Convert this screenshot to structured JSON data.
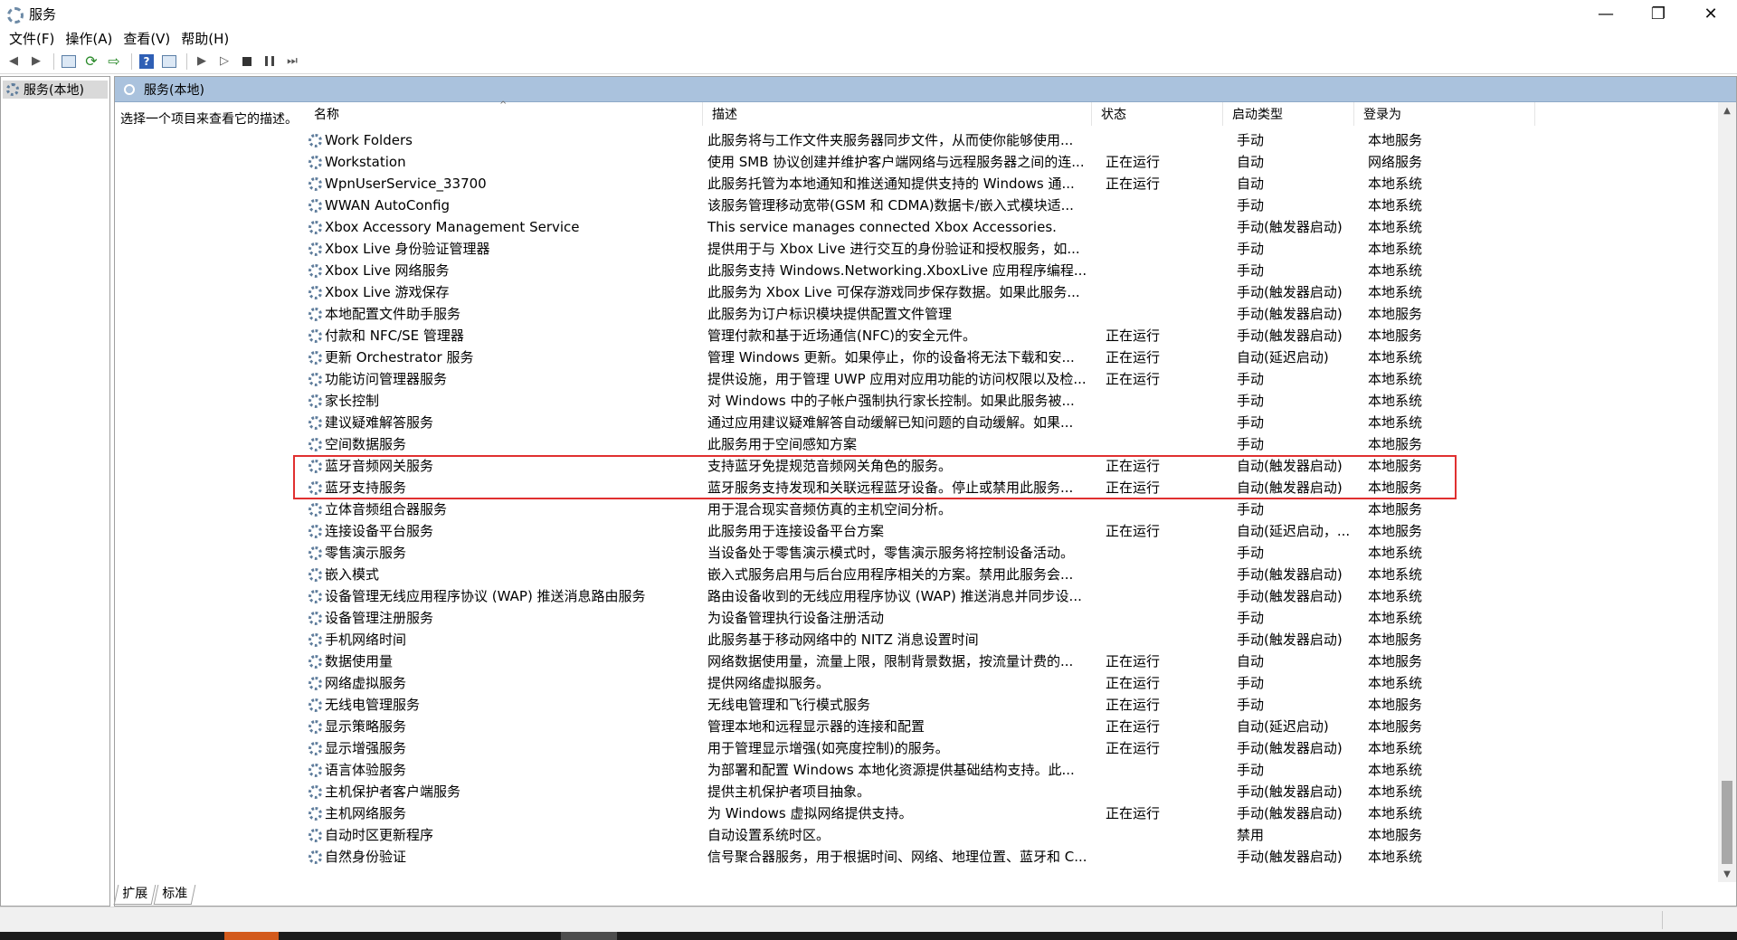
{
  "window": {
    "title": "服务",
    "minimize": "—",
    "maximize": "❐",
    "close": "✕"
  },
  "menu": [
    "文件(F)",
    "操作(A)",
    "查看(V)",
    "帮助(H)"
  ],
  "tree": {
    "root_label": "服务(本地)"
  },
  "header": {
    "title": "服务(本地)"
  },
  "description_panel": "选择一个项目来查看它的描述。",
  "columns": {
    "name": "名称",
    "desc": "描述",
    "status": "状态",
    "start": "启动类型",
    "logon": "登录为"
  },
  "rows": [
    {
      "name": "Work Folders",
      "desc": "此服务将与工作文件夹服务器同步文件，从而使你能够使用...",
      "status": "",
      "start": "手动",
      "logon": "本地服务"
    },
    {
      "name": "Workstation",
      "desc": "使用 SMB 协议创建并维护客户端网络与远程服务器之间的连...",
      "status": "正在运行",
      "start": "自动",
      "logon": "网络服务"
    },
    {
      "name": "WpnUserService_33700",
      "desc": "此服务托管为本地通知和推送通知提供支持的 Windows 通...",
      "status": "正在运行",
      "start": "自动",
      "logon": "本地系统"
    },
    {
      "name": "WWAN AutoConfig",
      "desc": "该服务管理移动宽带(GSM 和 CDMA)数据卡/嵌入式模块适...",
      "status": "",
      "start": "手动",
      "logon": "本地系统"
    },
    {
      "name": "Xbox Accessory Management Service",
      "desc": "This service manages connected Xbox Accessories.",
      "status": "",
      "start": "手动(触发器启动)",
      "logon": "本地系统"
    },
    {
      "name": "Xbox Live 身份验证管理器",
      "desc": "提供用于与 Xbox Live 进行交互的身份验证和授权服务，如...",
      "status": "",
      "start": "手动",
      "logon": "本地系统"
    },
    {
      "name": "Xbox Live 网络服务",
      "desc": "此服务支持 Windows.Networking.XboxLive 应用程序编程...",
      "status": "",
      "start": "手动",
      "logon": "本地系统"
    },
    {
      "name": "Xbox Live 游戏保存",
      "desc": "此服务为 Xbox Live 可保存游戏同步保存数据。如果此服务...",
      "status": "",
      "start": "手动(触发器启动)",
      "logon": "本地系统"
    },
    {
      "name": "本地配置文件助手服务",
      "desc": "此服务为订户标识模块提供配置文件管理",
      "status": "",
      "start": "手动(触发器启动)",
      "logon": "本地服务"
    },
    {
      "name": "付款和 NFC/SE 管理器",
      "desc": "管理付款和基于近场通信(NFC)的安全元件。",
      "status": "正在运行",
      "start": "手动(触发器启动)",
      "logon": "本地服务"
    },
    {
      "name": "更新 Orchestrator 服务",
      "desc": "管理 Windows 更新。如果停止，你的设备将无法下载和安...",
      "status": "正在运行",
      "start": "自动(延迟启动)",
      "logon": "本地系统"
    },
    {
      "name": "功能访问管理器服务",
      "desc": "提供设施，用于管理 UWP 应用对应用功能的访问权限以及检...",
      "status": "正在运行",
      "start": "手动",
      "logon": "本地系统"
    },
    {
      "name": "家长控制",
      "desc": "对 Windows 中的子帐户强制执行家长控制。如果此服务被...",
      "status": "",
      "start": "手动",
      "logon": "本地系统"
    },
    {
      "name": "建议疑难解答服务",
      "desc": "通过应用建议疑难解答自动缓解已知问题的自动缓解。如果...",
      "status": "",
      "start": "手动",
      "logon": "本地系统"
    },
    {
      "name": "空间数据服务",
      "desc": "此服务用于空间感知方案",
      "status": "",
      "start": "手动",
      "logon": "本地服务"
    },
    {
      "name": "蓝牙音频网关服务",
      "desc": "支持蓝牙免提规范音频网关角色的服务。",
      "status": "正在运行",
      "start": "自动(触发器启动)",
      "logon": "本地服务"
    },
    {
      "name": "蓝牙支持服务",
      "desc": "蓝牙服务支持发现和关联远程蓝牙设备。停止或禁用此服务...",
      "status": "正在运行",
      "start": "自动(触发器启动)",
      "logon": "本地服务"
    },
    {
      "name": "立体音频组合器服务",
      "desc": "用于混合现实音频仿真的主机空间分析。",
      "status": "",
      "start": "手动",
      "logon": "本地服务"
    },
    {
      "name": "连接设备平台服务",
      "desc": "此服务用于连接设备平台方案",
      "status": "正在运行",
      "start": "自动(延迟启动，...",
      "logon": "本地服务"
    },
    {
      "name": "零售演示服务",
      "desc": "当设备处于零售演示模式时，零售演示服务将控制设备活动。",
      "status": "",
      "start": "手动",
      "logon": "本地系统"
    },
    {
      "name": "嵌入模式",
      "desc": "嵌入式服务启用与后台应用程序相关的方案。禁用此服务会...",
      "status": "",
      "start": "手动(触发器启动)",
      "logon": "本地系统"
    },
    {
      "name": "设备管理无线应用程序协议 (WAP) 推送消息路由服务",
      "desc": "路由设备收到的无线应用程序协议 (WAP) 推送消息并同步设...",
      "status": "",
      "start": "手动(触发器启动)",
      "logon": "本地系统"
    },
    {
      "name": "设备管理注册服务",
      "desc": "为设备管理执行设备注册活动",
      "status": "",
      "start": "手动",
      "logon": "本地系统"
    },
    {
      "name": "手机网络时间",
      "desc": "此服务基于移动网络中的 NITZ 消息设置时间",
      "status": "",
      "start": "手动(触发器启动)",
      "logon": "本地服务"
    },
    {
      "name": "数据使用量",
      "desc": "网络数据使用量，流量上限，限制背景数据，按流量计费的...",
      "status": "正在运行",
      "start": "自动",
      "logon": "本地服务"
    },
    {
      "name": "网络虚拟服务",
      "desc": "提供网络虚拟服务。",
      "status": "正在运行",
      "start": "手动",
      "logon": "本地系统"
    },
    {
      "name": "无线电管理服务",
      "desc": "无线电管理和飞行模式服务",
      "status": "正在运行",
      "start": "手动",
      "logon": "本地服务"
    },
    {
      "name": "显示策略服务",
      "desc": "管理本地和远程显示器的连接和配置",
      "status": "正在运行",
      "start": "自动(延迟启动)",
      "logon": "本地服务"
    },
    {
      "name": "显示增强服务",
      "desc": "用于管理显示增强(如亮度控制)的服务。",
      "status": "正在运行",
      "start": "手动(触发器启动)",
      "logon": "本地系统"
    },
    {
      "name": "语言体验服务",
      "desc": "为部署和配置 Windows 本地化资源提供基础结构支持。此...",
      "status": "",
      "start": "手动",
      "logon": "本地系统"
    },
    {
      "name": "主机保护者客户端服务",
      "desc": "提供主机保护者项目抽象。",
      "status": "",
      "start": "手动(触发器启动)",
      "logon": "本地系统"
    },
    {
      "name": "主机网络服务",
      "desc": "为 Windows 虚拟网络提供支持。",
      "status": "正在运行",
      "start": "手动(触发器启动)",
      "logon": "本地系统"
    },
    {
      "name": "自动时区更新程序",
      "desc": "自动设置系统时区。",
      "status": "",
      "start": "禁用",
      "logon": "本地服务"
    },
    {
      "name": "自然身份验证",
      "desc": "信号聚合器服务，用于根据时间、网络、地理位置、蓝牙和 C...",
      "status": "",
      "start": "手动(触发器启动)",
      "logon": "本地系统"
    }
  ],
  "tabs": [
    "扩展",
    "标准"
  ],
  "colors": {
    "header_bg": "#aac2dd",
    "highlight_border": "#e03030",
    "taskbar": "#1c1c1c",
    "taskbar_active": "#d35a1c"
  }
}
